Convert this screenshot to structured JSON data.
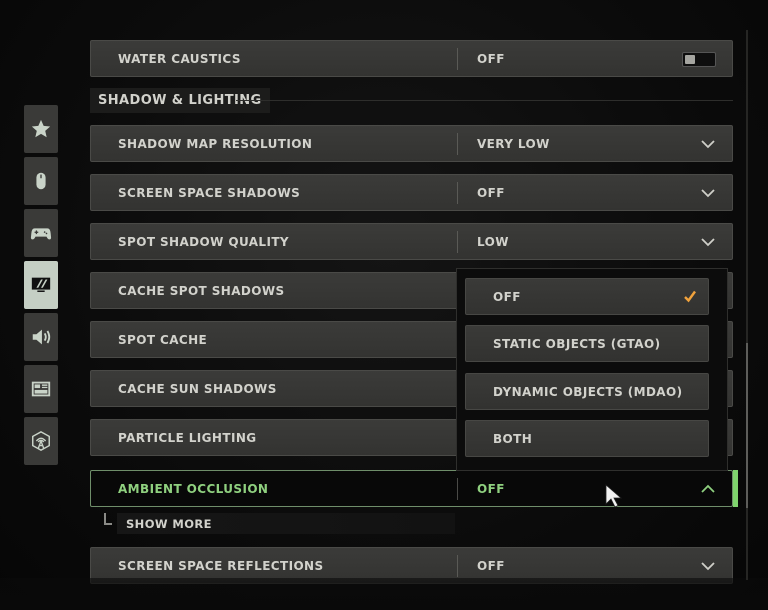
{
  "sidebar": {
    "items": [
      {
        "id": "favorites",
        "icon": "star-icon",
        "active": false
      },
      {
        "id": "mouse",
        "icon": "mouse-icon",
        "active": false
      },
      {
        "id": "controller",
        "icon": "controller-icon",
        "active": false
      },
      {
        "id": "graphics",
        "icon": "monitor-icon",
        "active": true
      },
      {
        "id": "audio",
        "icon": "speaker-icon",
        "active": false
      },
      {
        "id": "interface",
        "icon": "layout-icon",
        "active": false
      },
      {
        "id": "network",
        "icon": "network-tower-icon",
        "active": false
      }
    ]
  },
  "top_row": {
    "name": "WATER CAUSTICS",
    "value": "OFF",
    "control": "toggle",
    "toggle_on": false
  },
  "section": {
    "title": "SHADOW & LIGHTING"
  },
  "rows": [
    {
      "name": "SHADOW MAP RESOLUTION",
      "value": "VERY LOW",
      "control": "dropdown"
    },
    {
      "name": "SCREEN SPACE SHADOWS",
      "value": "OFF",
      "control": "dropdown"
    },
    {
      "name": "SPOT SHADOW QUALITY",
      "value": "LOW",
      "control": "dropdown"
    },
    {
      "name": "CACHE SPOT SHADOWS",
      "value": "",
      "control": "dropdown"
    },
    {
      "name": "SPOT CACHE",
      "value": "",
      "control": "dropdown"
    },
    {
      "name": "CACHE SUN SHADOWS",
      "value": "",
      "control": "dropdown"
    },
    {
      "name": "PARTICLE LIGHTING",
      "value": "",
      "control": "dropdown"
    }
  ],
  "active_row": {
    "name": "AMBIENT OCCLUSION",
    "value": "OFF",
    "expanded": true
  },
  "dropdown": {
    "options": [
      {
        "label": "OFF",
        "selected": true
      },
      {
        "label": "STATIC OBJECTS (GTAO)",
        "selected": false
      },
      {
        "label": "DYNAMIC OBJECTS (MDAO)",
        "selected": false
      },
      {
        "label": "BOTH",
        "selected": false
      }
    ]
  },
  "show_more": {
    "label": "SHOW MORE"
  },
  "bottom_row": {
    "name": "SCREEN SPACE REFLECTIONS",
    "value": "OFF",
    "control": "dropdown"
  },
  "colors": {
    "accent_green": "#7fd46d",
    "check_orange": "#f0a23c",
    "row_bg": "#373735",
    "active_tab_bg": "#c5cfc4"
  }
}
